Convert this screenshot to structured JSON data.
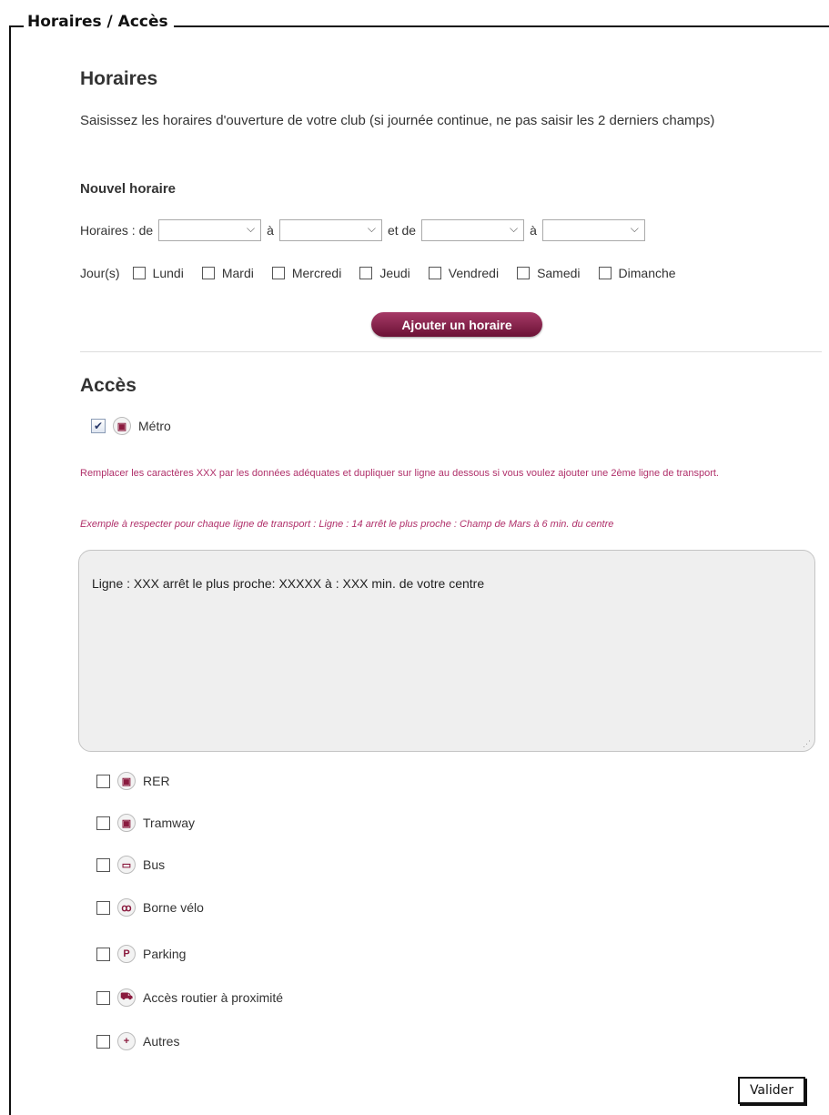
{
  "legend": "Horaires / Accès",
  "horaires": {
    "title": "Horaires",
    "intro": "Saisissez les horaires d'ouverture de votre club (si journée continue, ne pas saisir les 2 derniers champs)",
    "subhead": "Nouvel horaire",
    "row_label": "Horaires : de",
    "a1": "à",
    "et_de": "et de",
    "a2": "à",
    "jours_label": "Jour(s)",
    "days": [
      "Lundi",
      "Mardi",
      "Mercredi",
      "Jeudi",
      "Vendredi",
      "Samedi",
      "Dimanche"
    ],
    "add_button": "Ajouter un horaire"
  },
  "acces": {
    "title": "Accès",
    "metro_label": "Métro",
    "metro_checked": true,
    "note1": "Remplacer les caractères XXX par les données adéquates et dupliquer sur ligne au dessous si vous voulez ajouter une 2ème ligne de transport.",
    "note2": "Exemple à respecter pour chaque ligne de transport : Ligne : 14 arrêt le plus proche : Champ de Mars à 6 min. du centre",
    "textarea_value": "Ligne : XXX arrêt le plus proche: XXXXX à : XXX min. de votre centre",
    "items": [
      {
        "label": "RER",
        "icon": "train-icon"
      },
      {
        "label": "Tramway",
        "icon": "tram-icon"
      },
      {
        "label": "Bus",
        "icon": "bus-icon"
      },
      {
        "label": "Borne vélo",
        "icon": "bike-icon"
      },
      {
        "label": "Parking",
        "icon": "parking-icon"
      },
      {
        "label": "Accès routier à proximité",
        "icon": "car-icon"
      },
      {
        "label": "Autres",
        "icon": "plus-icon"
      }
    ]
  },
  "valider_button": "Valider",
  "colors": {
    "accent": "#8a1a3e",
    "note": "#b0306a"
  }
}
